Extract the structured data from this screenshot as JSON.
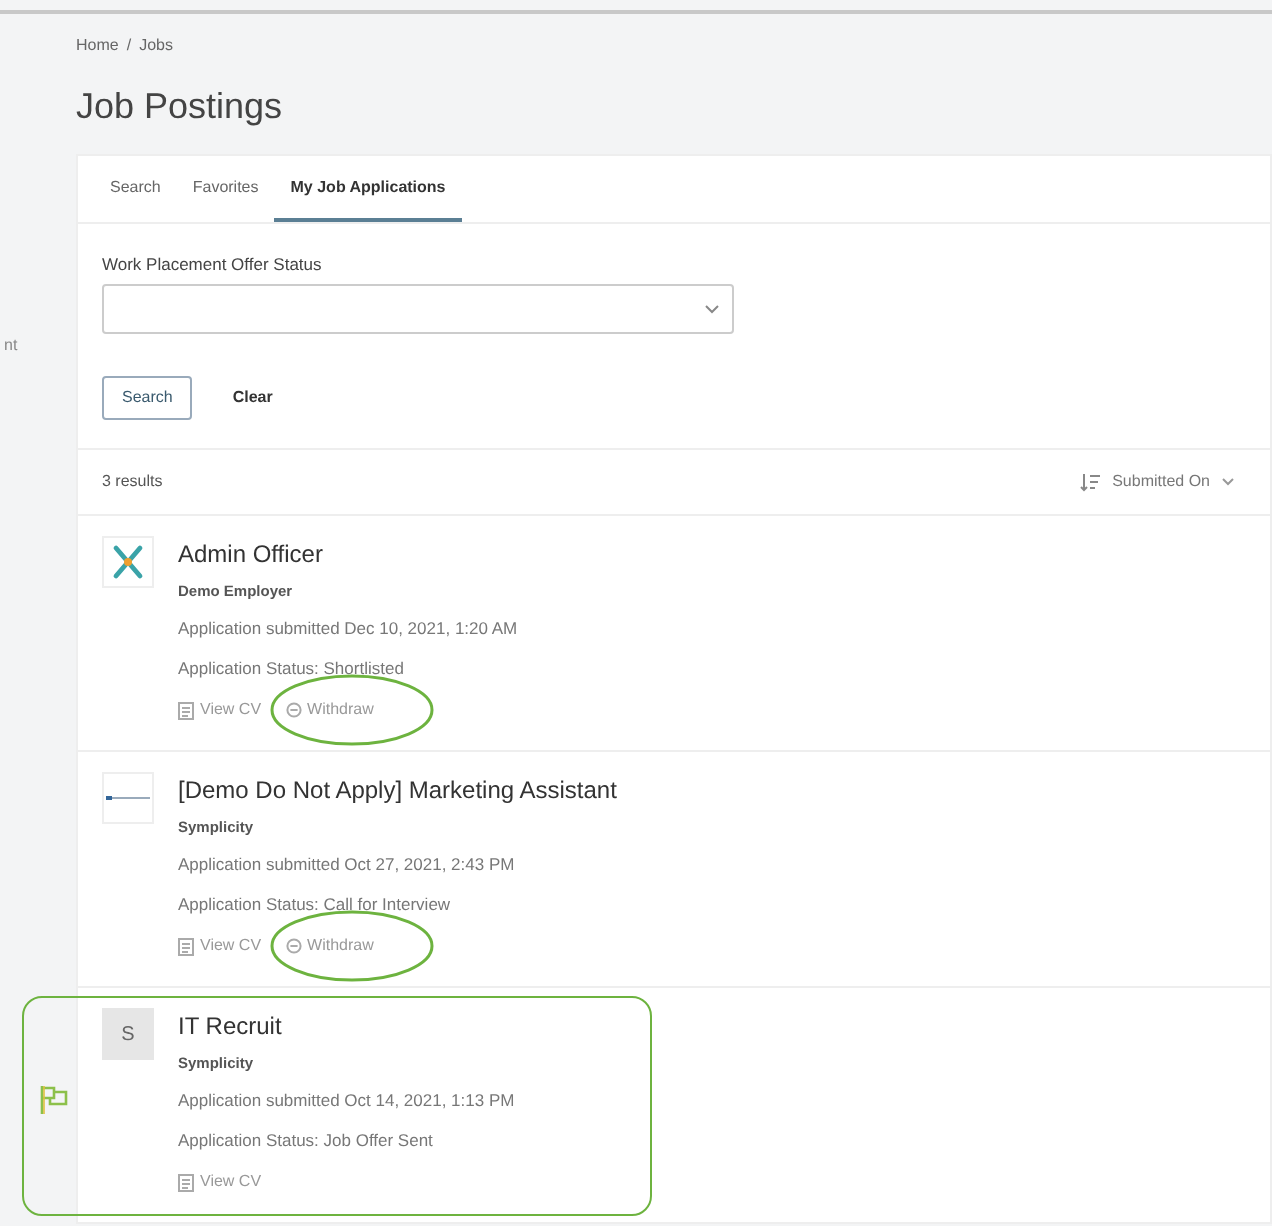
{
  "sidebar": {
    "clipped_text": "nt"
  },
  "breadcrumb": [
    "Home",
    "Jobs"
  ],
  "breadcrumb_separator": "/",
  "title": "Job Postings",
  "tabs": [
    {
      "label": "Search",
      "selected": false
    },
    {
      "label": "Favorites",
      "selected": false
    },
    {
      "label": "My Job Applications",
      "selected": true
    }
  ],
  "filter": {
    "label": "Work Placement Offer Status"
  },
  "buttons": [
    {
      "label": "Search",
      "kind": "outline"
    },
    {
      "label": "Clear",
      "kind": "plain"
    }
  ],
  "results": {
    "count": "3 results",
    "sort": "Submitted On"
  },
  "applications": [
    {
      "title": "Admin Officer",
      "employer": "Demo Employer",
      "submitted": "Application submitted Dec 10, 2021, 1:20 AM",
      "status": "Application Status: Shortlisted",
      "logo": {
        "kind": "figure"
      },
      "highlighted": false,
      "actions": [
        {
          "label": "View CV",
          "kind": "cv",
          "circled": false
        },
        {
          "label": "Withdraw",
          "kind": "withdraw",
          "circled": true
        }
      ]
    },
    {
      "title": "[Demo Do Not Apply] Marketing Assistant",
      "employer": "Symplicity",
      "submitted": "Application submitted Oct 27, 2021, 2:43 PM",
      "status": "Application Status: Call for Interview",
      "logo": {
        "kind": "banner"
      },
      "highlighted": false,
      "actions": [
        {
          "label": "View CV",
          "kind": "cv",
          "circled": false
        },
        {
          "label": "Withdraw",
          "kind": "withdraw",
          "circled": true
        }
      ]
    },
    {
      "title": "IT Recruit",
      "employer": "Symplicity",
      "submitted": "Application submitted Oct 14, 2021, 1:13 PM",
      "status": "Application Status: Job Offer Sent",
      "logo": {
        "kind": "initial",
        "text": "S"
      },
      "highlighted": true,
      "actions": [
        {
          "label": "View CV",
          "kind": "cv",
          "circled": false
        }
      ]
    }
  ]
}
